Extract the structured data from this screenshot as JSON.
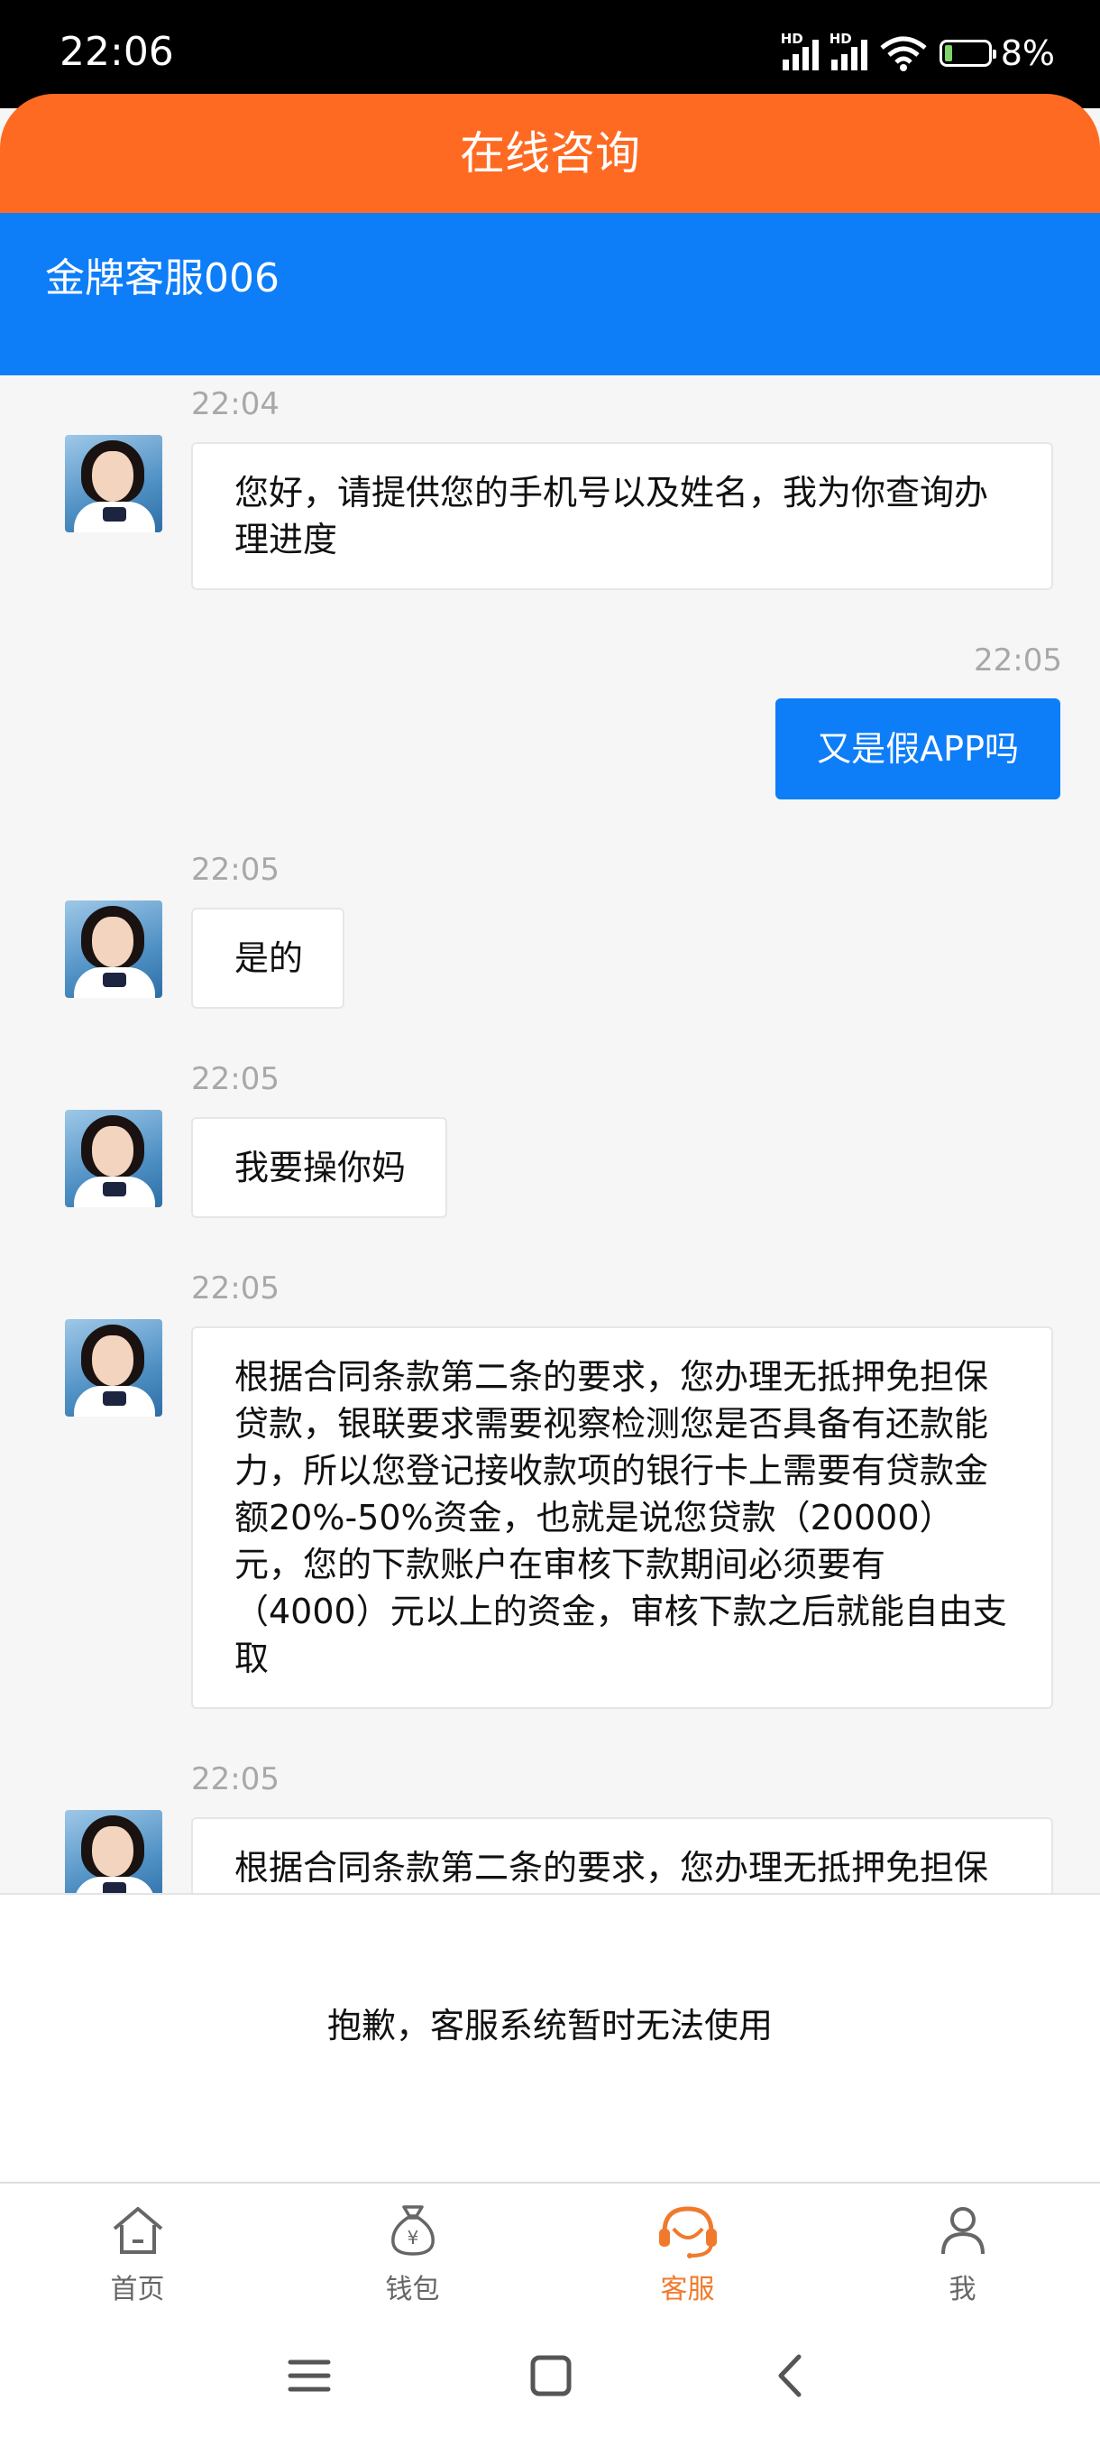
{
  "status_bar": {
    "time": "22:06",
    "signal_1_label": "HD",
    "signal_2_label": "HD",
    "battery": "8%"
  },
  "header": {
    "title": "在线咨询",
    "agent_name": "金牌客服006"
  },
  "messages": [
    {
      "side": "left",
      "time": "22:04",
      "text": "您好，请提供您的手机号以及姓名，我为你查询办理进度"
    },
    {
      "side": "right",
      "time": "22:05",
      "text": "又是假APP吗"
    },
    {
      "side": "left",
      "time": "22:05",
      "text": "是的"
    },
    {
      "side": "left",
      "time": "22:05",
      "text": "我要操你妈"
    },
    {
      "side": "left",
      "time": "22:05",
      "text": "根据合同条款第二条的要求，您办理无抵押免担保贷款，银联要求需要视察检测您是否具备有还款能力，所以您登记接收款项的银行卡上需要有贷款金额20%-50%资金，也就是说您贷款（20000）元，您的下款账户在审核下款期间必须要有（4000）元以上的资金，审核下款之后就能自由支取"
    },
    {
      "side": "left",
      "time": "22:05",
      "text": "根据合同条款第二条的要求，您办理无抵押免担保"
    }
  ],
  "notice": "抱歉，客服系统暂时无法使用",
  "tabbar": {
    "home": "首页",
    "wallet": "钱包",
    "wallet_icon_glyph": "¥",
    "service": "客服",
    "me": "我",
    "active_color": "#f07a2c"
  },
  "colors": {
    "orange": "#ff6a22",
    "blue": "#0d7df8"
  }
}
